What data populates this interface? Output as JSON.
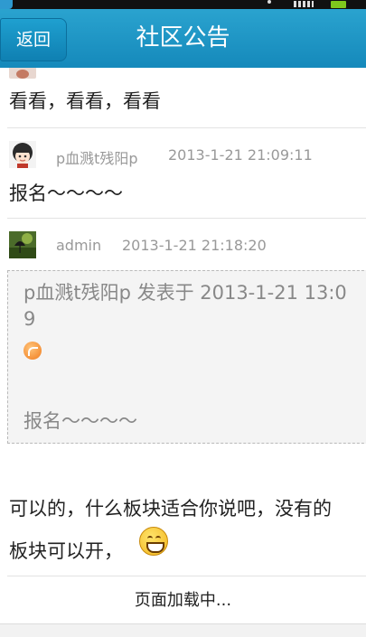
{
  "header": {
    "back_label": "返回",
    "title": "社区公告"
  },
  "posts": [
    {
      "body": "看看，看看，看看"
    },
    {
      "author": "p血溅t残阳p",
      "time": "2013-1-21 21:09:11",
      "body": "报名～～～～"
    },
    {
      "author": "admin",
      "time": "2013-1-21 21:18:20",
      "quote": {
        "line1": "p血溅t残阳p 发表于 2013-1-21 13:0",
        "line2": "9",
        "body": "报名～～～～"
      },
      "body_line1": "可以的，什么板块适合你说吧，没有的",
      "body_line2": "板块可以开，"
    }
  ],
  "footer": {
    "loading_text": "页面加载中..."
  },
  "icons": {
    "back": "back-arrow-icon",
    "quote": "quote-reply-icon",
    "emoji": "grin-emoji-icon"
  }
}
